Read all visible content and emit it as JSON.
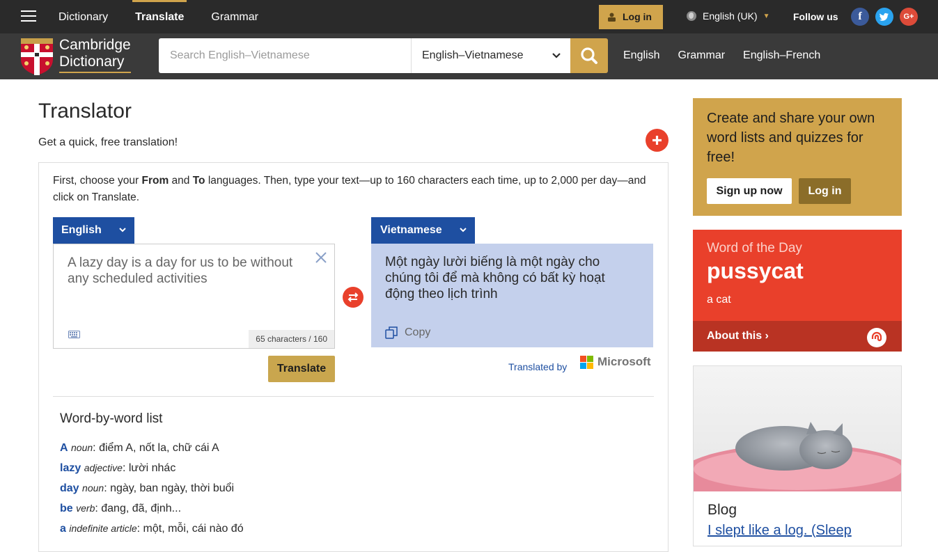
{
  "topnav": {
    "items": [
      {
        "label": "Dictionary",
        "active": false
      },
      {
        "label": "Translate",
        "active": true
      },
      {
        "label": "Grammar",
        "active": false
      }
    ],
    "login_label": "Log in",
    "language_label": "English (UK)",
    "follow_label": "Follow us",
    "social": [
      {
        "name": "facebook-icon",
        "glyph": "f"
      },
      {
        "name": "twitter-icon",
        "glyph": "t"
      },
      {
        "name": "google-plus-icon",
        "glyph": "G+"
      }
    ]
  },
  "header": {
    "brand_line1": "Cambridge",
    "brand_line2": "Dictionary",
    "search_placeholder": "Search English–Vietnamese",
    "dictionary_select": "English–Vietnamese",
    "links": [
      "English",
      "Grammar",
      "English–French"
    ]
  },
  "translator": {
    "title": "Translator",
    "subtitle": "Get a quick, free translation!",
    "instructions_pre": "First, choose your ",
    "instructions_from": "From",
    "instructions_and": " and ",
    "instructions_to": "To",
    "instructions_post": " languages. Then, type your text—up to 160 characters each time, up to 2,000 per day—and click on Translate.",
    "from_language": "English",
    "to_language": "Vietnamese",
    "input_text": "A lazy day is a day for us to be without any scheduled activities",
    "char_count": "65 characters / 160",
    "output_text": "Một ngày lười biếng là một ngày cho chúng tôi để mà không có bất kỳ hoạt động theo lịch trình",
    "copy_label": "Copy",
    "translate_label": "Translate",
    "translated_by": "Translated by",
    "provider": "Microsoft"
  },
  "word_by_word": {
    "title": "Word-by-word list",
    "items": [
      {
        "word": "A",
        "pos": "noun",
        "meaning": ": điểm A, nốt la, chữ cái A"
      },
      {
        "word": "lazy",
        "pos": "adjective",
        "meaning": ": lười nhác"
      },
      {
        "word": "day",
        "pos": "noun",
        "meaning": ": ngày, ban ngày, thời buổi"
      },
      {
        "word": "be",
        "pos": "verb",
        "meaning": ": đang, đã, định..."
      },
      {
        "word": "a",
        "pos": "indefinite article",
        "meaning": ": một, mỗi, cái nào đó"
      }
    ]
  },
  "sidebar": {
    "promo_text": "Create and share your own word lists and quizzes for free!",
    "signup_label": "Sign up now",
    "login_label": "Log in",
    "wotd_label": "Word of the Day",
    "wotd_word": "pussycat",
    "wotd_definition": "a cat",
    "about_label": "About this ›",
    "blog_label": "Blog",
    "blog_link": "I slept like a log. (Sleep"
  },
  "colors": {
    "gold": "#d0a44c",
    "blue": "#1e4fa1",
    "red": "#e9402b",
    "dark": "#2a2a2a"
  }
}
